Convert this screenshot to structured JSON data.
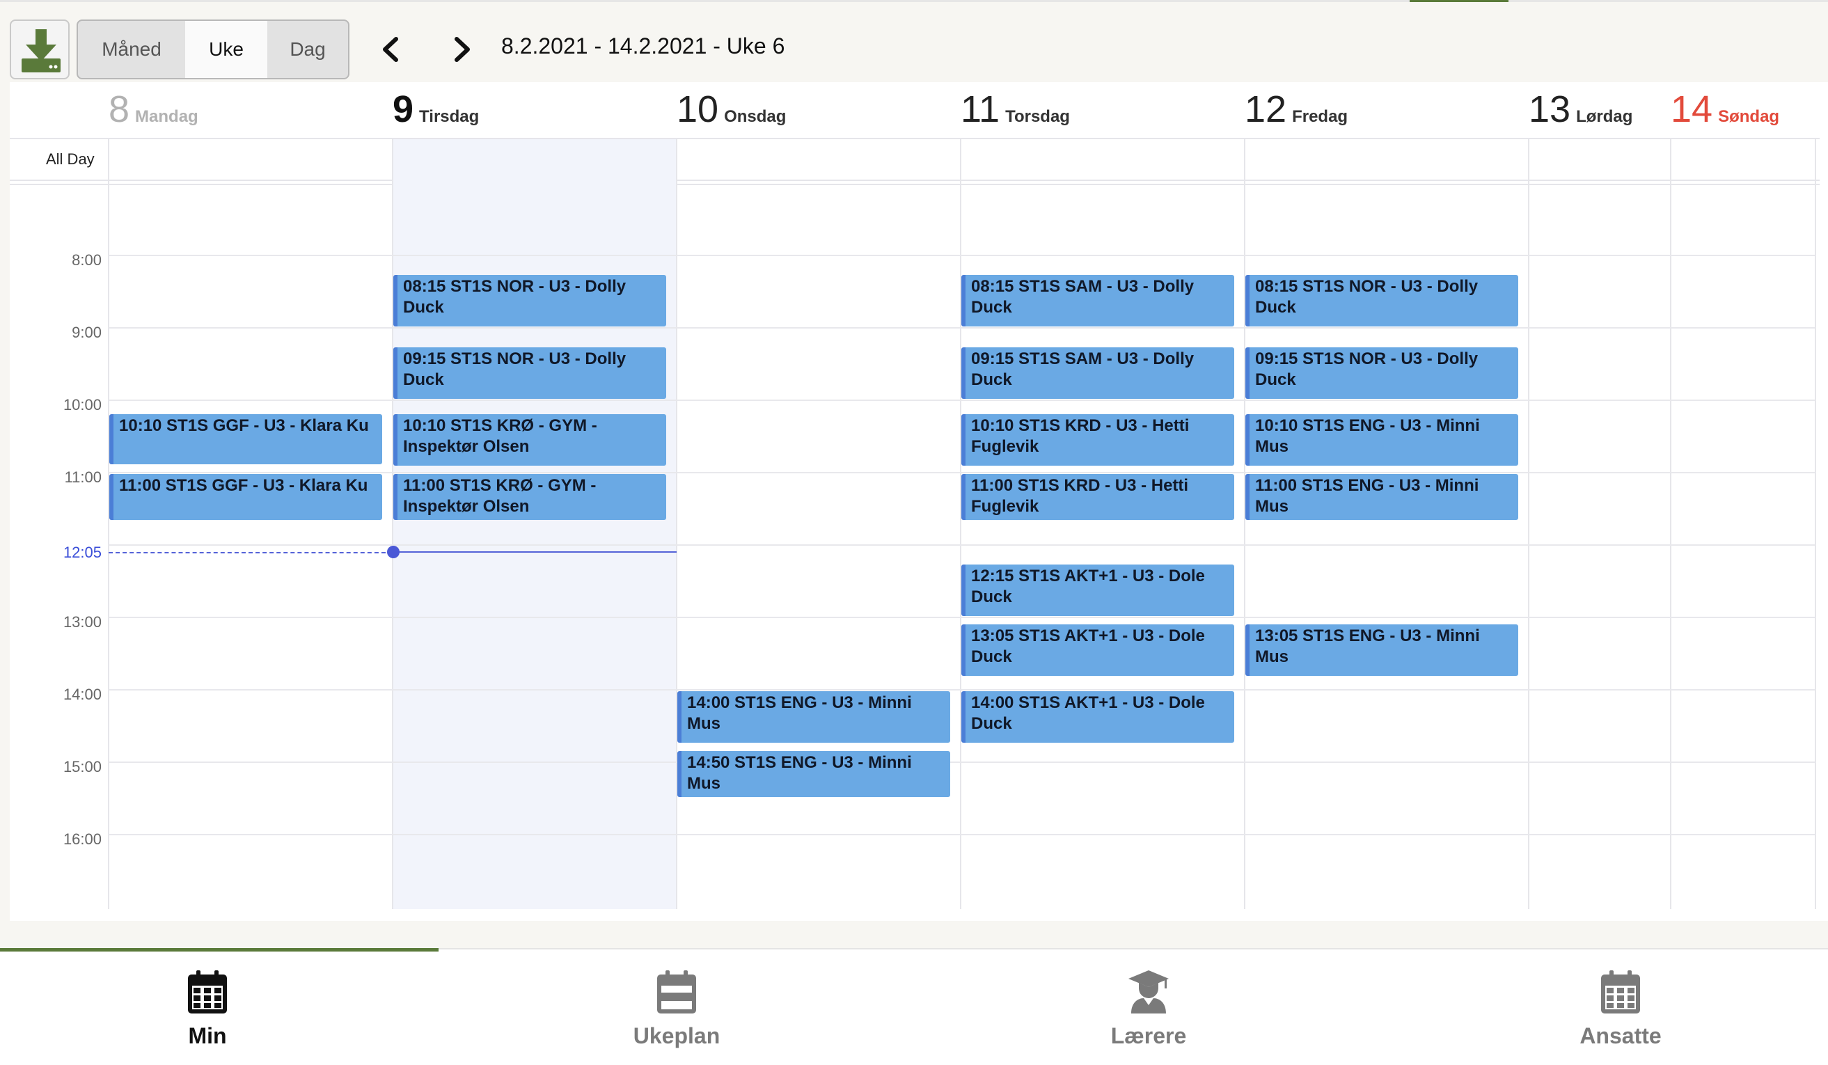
{
  "toolbar": {
    "download_icon": "download-icon",
    "views": {
      "month": "Måned",
      "week": "Uke",
      "day": "Dag"
    },
    "active_view": "Uke",
    "prev_icon": "chevron-left-icon",
    "next_icon": "chevron-right-icon",
    "date_range": "8.2.2021 - 14.2.2021 - Uke 6"
  },
  "calendar": {
    "all_day_label": "All Day",
    "days": [
      {
        "num": "8",
        "name": "Mandag",
        "state": "past"
      },
      {
        "num": "9",
        "name": "Tirsdag",
        "state": "today"
      },
      {
        "num": "10",
        "name": "Onsdag",
        "state": "normal"
      },
      {
        "num": "11",
        "name": "Torsdag",
        "state": "normal"
      },
      {
        "num": "12",
        "name": "Fredag",
        "state": "normal"
      },
      {
        "num": "13",
        "name": "Lørdag",
        "state": "normal"
      },
      {
        "num": "14",
        "name": "Søndag",
        "state": "sunday"
      }
    ],
    "time_labels": [
      "8:00",
      "9:00",
      "10:00",
      "11:00",
      "13:00",
      "14:00",
      "15:00",
      "16:00"
    ],
    "now_label": "12:05",
    "events": [
      {
        "day": "Mandag",
        "text": "10:10 ST1S GGF - U3 - Klara Ku"
      },
      {
        "day": "Mandag",
        "text": "11:00 ST1S GGF - U3 - Klara Ku"
      },
      {
        "day": "Tirsdag",
        "text": "08:15 ST1S NOR - U3 - Dolly Duck"
      },
      {
        "day": "Tirsdag",
        "text": "09:15 ST1S NOR - U3 - Dolly Duck"
      },
      {
        "day": "Tirsdag",
        "text": "10:10 ST1S KRØ - GYM - Inspektør Olsen"
      },
      {
        "day": "Tirsdag",
        "text": "11:00 ST1S KRØ - GYM - Inspektør Olsen"
      },
      {
        "day": "Onsdag",
        "text": "14:00 ST1S ENG - U3 - Minni Mus"
      },
      {
        "day": "Onsdag",
        "text": "14:50 ST1S ENG - U3 - Minni Mus"
      },
      {
        "day": "Torsdag",
        "text": "08:15 ST1S SAM - U3 - Dolly Duck"
      },
      {
        "day": "Torsdag",
        "text": "09:15 ST1S SAM - U3 - Dolly Duck"
      },
      {
        "day": "Torsdag",
        "text": "10:10 ST1S KRD - U3 - Hetti Fuglevik"
      },
      {
        "day": "Torsdag",
        "text": "11:00 ST1S KRD - U3 - Hetti Fuglevik"
      },
      {
        "day": "Torsdag",
        "text": "12:15 ST1S AKT+1 - U3 - Dole Duck"
      },
      {
        "day": "Torsdag",
        "text": "13:05 ST1S AKT+1 - U3 - Dole Duck"
      },
      {
        "day": "Torsdag",
        "text": "14:00 ST1S AKT+1 - U3 - Dole Duck"
      },
      {
        "day": "Fredag",
        "text": "08:15 ST1S NOR - U3 - Dolly Duck"
      },
      {
        "day": "Fredag",
        "text": "09:15 ST1S NOR - U3 - Dolly Duck"
      },
      {
        "day": "Fredag",
        "text": "10:10 ST1S ENG - U3 - Minni Mus"
      },
      {
        "day": "Fredag",
        "text": "11:00 ST1S ENG - U3 - Minni Mus"
      },
      {
        "day": "Fredag",
        "text": "13:05 ST1S ENG - U3 - Minni Mus"
      }
    ]
  },
  "bottom_nav": {
    "tabs": [
      {
        "label": "Min",
        "icon": "calendar-grid-icon",
        "active": true
      },
      {
        "label": "Ukeplan",
        "icon": "calendar-week-icon",
        "active": false
      },
      {
        "label": "Lærere",
        "icon": "teacher-icon",
        "active": false
      },
      {
        "label": "Ansatte",
        "icon": "calendar-grid-icon",
        "active": false
      }
    ]
  },
  "colors": {
    "accent": "#5a7a3a",
    "event_fill": "#6aa9e4",
    "event_border": "#4b7ed6",
    "now_line": "#4a58d6",
    "sunday": "#e24a3b"
  }
}
